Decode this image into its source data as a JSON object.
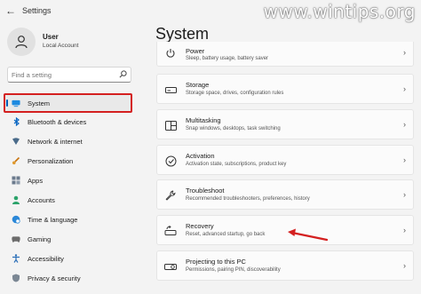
{
  "window": {
    "title": "Settings",
    "watermark": "www.wintips.org"
  },
  "user": {
    "name": "User",
    "subtitle": "Local Account"
  },
  "search": {
    "placeholder": "Find a setting"
  },
  "sidebar": {
    "items": [
      {
        "label": "System",
        "icon": "monitor-icon",
        "selected": true
      },
      {
        "label": "Bluetooth & devices",
        "icon": "bluetooth-icon"
      },
      {
        "label": "Network & internet",
        "icon": "wifi-icon"
      },
      {
        "label": "Personalization",
        "icon": "brush-icon"
      },
      {
        "label": "Apps",
        "icon": "apps-icon"
      },
      {
        "label": "Accounts",
        "icon": "person-icon"
      },
      {
        "label": "Time & language",
        "icon": "globe-clock-icon"
      },
      {
        "label": "Gaming",
        "icon": "gamepad-icon"
      },
      {
        "label": "Accessibility",
        "icon": "accessibility-icon"
      },
      {
        "label": "Privacy & security",
        "icon": "shield-icon"
      }
    ]
  },
  "main": {
    "title": "System",
    "cards": [
      {
        "title": "Power",
        "subtitle": "Sleep, battery usage, battery saver",
        "icon": "power-icon"
      },
      {
        "title": "Storage",
        "subtitle": "Storage space, drives, configuration rules",
        "icon": "storage-icon"
      },
      {
        "title": "Multitasking",
        "subtitle": "Snap windows, desktops, task switching",
        "icon": "multitasking-icon"
      },
      {
        "title": "Activation",
        "subtitle": "Activation state, subscriptions, product key",
        "icon": "check-circle-icon"
      },
      {
        "title": "Troubleshoot",
        "subtitle": "Recommended troubleshooters, preferences, history",
        "icon": "wrench-icon"
      },
      {
        "title": "Recovery",
        "subtitle": "Reset, advanced startup, go back",
        "icon": "recovery-icon"
      },
      {
        "title": "Projecting to this PC",
        "subtitle": "Permissions, pairing PIN, discoverability",
        "icon": "projector-icon"
      }
    ]
  },
  "colors": {
    "accent": "#005fb8",
    "highlight": "#d42020",
    "background": "#f3f3f3"
  }
}
